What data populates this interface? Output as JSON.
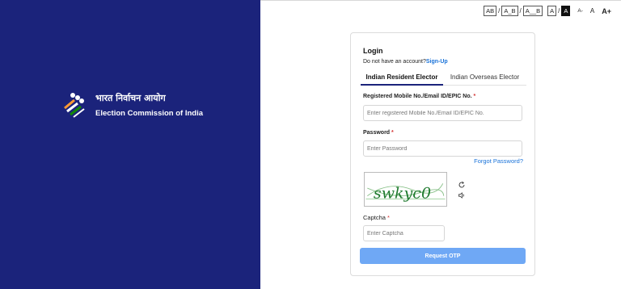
{
  "brand": {
    "hindi_name": "भारत निर्वाचन आयोग",
    "english_name": "Election Commission of India",
    "logo_icon": "eci-logo-icon"
  },
  "accessibility": {
    "contrast_labels": [
      "AB",
      "A_B",
      "A__B"
    ],
    "theme_light": "A",
    "theme_dark": "A",
    "font_decrease": "A-",
    "font_normal": "A",
    "font_increase": "A+",
    "separator": "/"
  },
  "login": {
    "title": "Login",
    "signup_prompt": "Do not have an account?",
    "signup_link": "Sign-Up",
    "tabs": [
      {
        "label": "Indian Resident Elector",
        "active": true
      },
      {
        "label": "Indian Overseas Elector",
        "active": false
      }
    ],
    "mobile_label": "Registered Mobile No./Email ID/EPIC No.",
    "mobile_placeholder": "Enter registered Mobile No./Email ID/EPIC No.",
    "password_label": "Password",
    "password_placeholder": "Enter Password",
    "required_mark": "*",
    "forgot_password": "Forgot Password?",
    "captcha_text": "swkyc0",
    "refresh_icon": "refresh-icon",
    "audio_icon": "speaker-icon",
    "captcha_label": "Captcha",
    "captcha_placeholder": "Enter Captcha",
    "submit_label": "Request OTP"
  },
  "colors": {
    "brand_navy": "#1b237b",
    "link_blue": "#1a73d9",
    "button_blue": "#6fa8f5",
    "required_red": "#d32f2f"
  }
}
